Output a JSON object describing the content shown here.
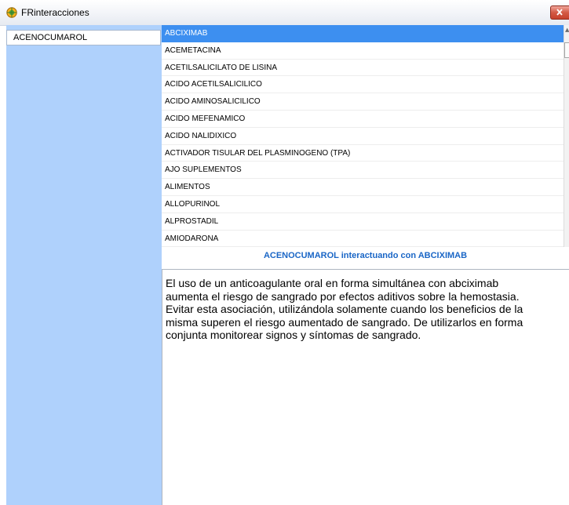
{
  "window": {
    "title": "FRinteracciones"
  },
  "left_panel": {
    "selected_drug": "ACENOCUMAROL"
  },
  "drug_list": {
    "items": [
      "ABCIXIMAB",
      "ACEMETACINA",
      "ACETILSALICILATO DE LISINA",
      "ACIDO ACETILSALICILICO",
      "ACIDO AMINOSALICILICO",
      "ACIDO MEFENAMICO",
      "ACIDO NALIDIXICO",
      "ACTIVADOR TISULAR DEL PLASMINOGENO (TPA)",
      "AJO SUPLEMENTOS",
      "ALIMENTOS",
      "ALLOPURINOL",
      "ALPROSTADIL",
      "AMIODARONA"
    ],
    "selected_index": 0
  },
  "interaction": {
    "heading": "ACENOCUMAROL interactuando con  ABCIXIMAB",
    "lines": [
      "El uso de un anticoagulante oral en forma simultánea con abciximab",
      "aumenta el riesgo de sangrado por efectos aditivos sobre la hemostasia.",
      "Evitar esta asociación, utilizándola solamente cuando los beneficios de la",
      "misma superen el riesgo aumentado de sangrado. De utilizarlos en forma",
      "conjunta monitorear signos y síntomas de sangrado."
    ]
  },
  "colors": {
    "left_panel": "#afd1fc",
    "selection": "#3d8ff0",
    "heading": "#1a66c6"
  }
}
